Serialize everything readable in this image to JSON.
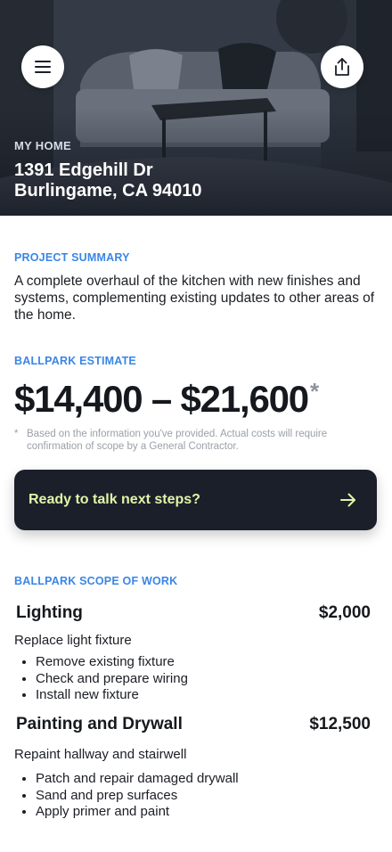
{
  "header": {
    "eyebrow": "MY HOME",
    "address_line1": "1391 Edgehill Dr",
    "address_line2": "Burlingame, CA 94010",
    "menu_icon": "menu-icon",
    "share_icon": "share-icon"
  },
  "summary": {
    "label": "PROJECT SUMMARY",
    "text": "A complete overhaul of the kitchen with new finishes and systems, complementing existing updates to other areas of the home."
  },
  "estimate": {
    "label": "BALLPARK ESTIMATE",
    "range": "$14,400 – $21,600",
    "asterisk": "*",
    "disclaimer_mark": "*",
    "disclaimer": "Based on the information you've provided. Actual costs will require confirmation of scope by a General Contractor."
  },
  "cta": {
    "label": "Ready to talk next steps?",
    "icon": "arrow-right-icon",
    "text_color": "#e3f4a7",
    "background": "#1b1f2a"
  },
  "scope": {
    "label": "BALLPARK SCOPE OF WORK",
    "items": [
      {
        "title": "Lighting",
        "price": "$2,000",
        "description": "Replace light fixture",
        "tasks": [
          "Remove existing fixture",
          "Check and prepare wiring",
          "Install new fixture"
        ]
      },
      {
        "title": "Painting and Drywall",
        "price": "$12,500",
        "description": "Repaint hallway and stairwell",
        "tasks": [
          "Patch and repair damaged drywall",
          "Sand and prep surfaces",
          "Apply primer and paint"
        ]
      }
    ]
  },
  "colors": {
    "accent": "#3a86e6",
    "text": "#15181d",
    "muted": "#9aa0a8"
  }
}
